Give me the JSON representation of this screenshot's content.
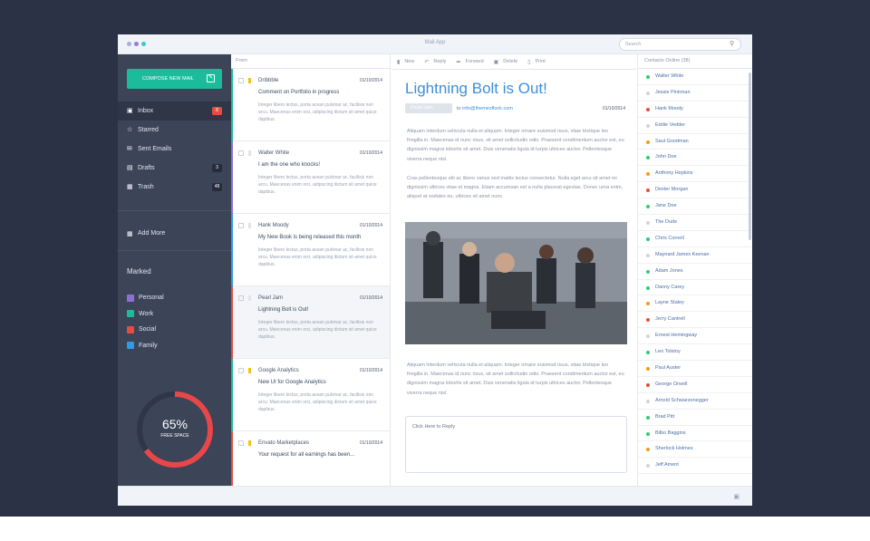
{
  "window": {
    "title": "Mail App",
    "search_placeholder": "Search",
    "dot_colors": [
      "#a6b0d8",
      "#8e7fe0",
      "#3cc9c0"
    ]
  },
  "sidebar": {
    "compose_label": "COMPOSE NEW MAIL",
    "nav": [
      {
        "label": "Inbox",
        "icon": "inbox-icon",
        "badge": "8",
        "badge_color": "red",
        "active": true
      },
      {
        "label": "Starred",
        "icon": "star-icon",
        "badge": ""
      },
      {
        "label": "Sent Emails",
        "icon": "send-icon",
        "badge": ""
      },
      {
        "label": "Drafts",
        "icon": "drafts-icon",
        "badge": "3"
      },
      {
        "label": "Trash",
        "icon": "trash-icon",
        "badge": "48"
      }
    ],
    "add_more": "Add More",
    "marked_heading": "Marked",
    "marked": [
      {
        "label": "Personal",
        "color": "#8e6fd8"
      },
      {
        "label": "Work",
        "color": "#1abc9c"
      },
      {
        "label": "Social",
        "color": "#e74c3c"
      },
      {
        "label": "Family",
        "color": "#2e9be8"
      }
    ],
    "storage": {
      "percent_label": "65%",
      "caption": "FREE SPACE",
      "fraction": 0.65
    }
  },
  "mail_list": {
    "header": "From",
    "mails": [
      {
        "from": "Dribbble",
        "date": "01/10/2014",
        "subject": "Comment on Portfolio in progress",
        "snippet": "Integer libero lectus, porta acean pulvinar ac, facilisis non arcu. Maecenas enim orci, adipiscing dictum sit amet quice dapibus.",
        "bar": "#1abc9c",
        "selected": false
      },
      {
        "from": "Walter White",
        "date": "01/10/2014",
        "subject": "I am the one who knocks!",
        "snippet": "Integer libero lectus, porta acean pulvinar ac, facilisis non arcu. Maecenas enim orci, adipiscing dictum sit amet quice dapibus.",
        "bar": "#8e6fd8",
        "selected": false
      },
      {
        "from": "Hank Moody",
        "date": "01/10/2014",
        "subject": "My New Book is being released this month",
        "snippet": "Integer libero lectus, porta acean pulvinar ac, facilisis non arcu. Maecenas enim orci, adipiscing dictum sit amet quice dapibus.",
        "bar": "#2e9be8",
        "selected": false
      },
      {
        "from": "Pearl Jam",
        "date": "01/10/2014",
        "subject": "Lightning Bolt is Out!",
        "snippet": "Integer libero lectus, porta acean pulvinar ac, facilisis non arcu. Maecenas enim orci, adipiscing dictum sit amet quice dapibus.",
        "bar": "#e74c3c",
        "selected": true
      },
      {
        "from": "Google Analytics",
        "date": "01/10/2014",
        "subject": "New UI for Google Analytics",
        "snippet": "Integer libero lectus, porta acean pulvinar ac, facilisis non arcu. Maecenas enim orci, adipiscing dictum sit amet quice dapibus.",
        "bar": "#1abc9c",
        "selected": false
      },
      {
        "from": "Envato Marketplaces",
        "date": "01/10/2014",
        "subject": "Your request for all earnings has been...",
        "snippet": "",
        "bar": "#e74c3c",
        "selected": false
      }
    ]
  },
  "toolbar": {
    "new": "New",
    "reply": "Reply",
    "forward": "Forward",
    "delete": "Delete",
    "print": "Print"
  },
  "reader": {
    "title": "Lightning Bolt  is Out!",
    "sender_tag": "Pearl Jam",
    "to_label": "to",
    "to_email": "info@themesflock.com",
    "date": "01/10/2014",
    "para1": "Aliquam interdum vehicula nulla et aliquam. Integer ornare euismod risus, vitae tristique leo fringilla in. Maecenas id nunc risus, sit amet sollicitudin odio. Praesent condimentum auctor est, eu dignissim magna lobortis sit amet. Duis venenatis ligula id turpis ultrices auctor. Pellentesque viverra neque nisl.",
    "para2": "Cras pellentesque elit ac libero varius sed mattis lectus consectetur. Nulla eget arcu sit amet mi dignissim ultrices vitae et magna. Etiam accumsan est a nulla placerat egestas. Donec urna enim, aliquet at sodales eu, ultrices sit amet nunc.",
    "para3": "Aliquam interdum vehicula nulla et aliquam. Integer ornare euismod risus, vitae tristique leo fringilla in. Maecenas id nunc risus, sit amet sollicitudin odio. Praesent condimentum auctor est, eu dignissim magna lobortis sit amet. Duis venenatis ligula id turpis ultrices auctor. Pellentesque viverra neque nisl.",
    "reply_placeholder": "Click Here to Reply"
  },
  "contacts": {
    "header": "Contacts Online (38)",
    "list": [
      {
        "name": "Walter White",
        "status": "#2ecc71"
      },
      {
        "name": "Jessie Pinkman",
        "status": "#d0d5dd"
      },
      {
        "name": "Hank Moody",
        "status": "#e74c3c"
      },
      {
        "name": "Eddie Vedder",
        "status": "#d0d5dd"
      },
      {
        "name": "Saul Goodman",
        "status": "#f39c12"
      },
      {
        "name": "John Doe",
        "status": "#2ecc71"
      },
      {
        "name": "Anthony Hopkins",
        "status": "#f39c12"
      },
      {
        "name": "Dexter Morgan",
        "status": "#e74c3c"
      },
      {
        "name": "Jane Doe",
        "status": "#2ecc71"
      },
      {
        "name": "The Dude",
        "status": "#d0d5dd"
      },
      {
        "name": "Chris Cornell",
        "status": "#2ecc71"
      },
      {
        "name": "Maynard James Keenan",
        "status": "#d0d5dd"
      },
      {
        "name": "Adam Jones",
        "status": "#2ecc71"
      },
      {
        "name": "Danny Carey",
        "status": "#2ecc71"
      },
      {
        "name": "Layne Staley",
        "status": "#f39c12"
      },
      {
        "name": "Jerry Cantrell",
        "status": "#e74c3c"
      },
      {
        "name": "Ernest Hemingway",
        "status": "#d0d5dd"
      },
      {
        "name": "Leo Tolstoy",
        "status": "#2ecc71"
      },
      {
        "name": "Paul Auster",
        "status": "#f39c12"
      },
      {
        "name": "George Orwell",
        "status": "#e74c3c"
      },
      {
        "name": "Arnold Schwarzenegger",
        "status": "#d0d5dd"
      },
      {
        "name": "Brad Pitt",
        "status": "#2ecc71"
      },
      {
        "name": "Bilbo Baggins",
        "status": "#2ecc71"
      },
      {
        "name": "Sherlock Holmes",
        "status": "#f39c12"
      },
      {
        "name": "Jeff Ament",
        "status": "#d0d5dd"
      }
    ]
  }
}
